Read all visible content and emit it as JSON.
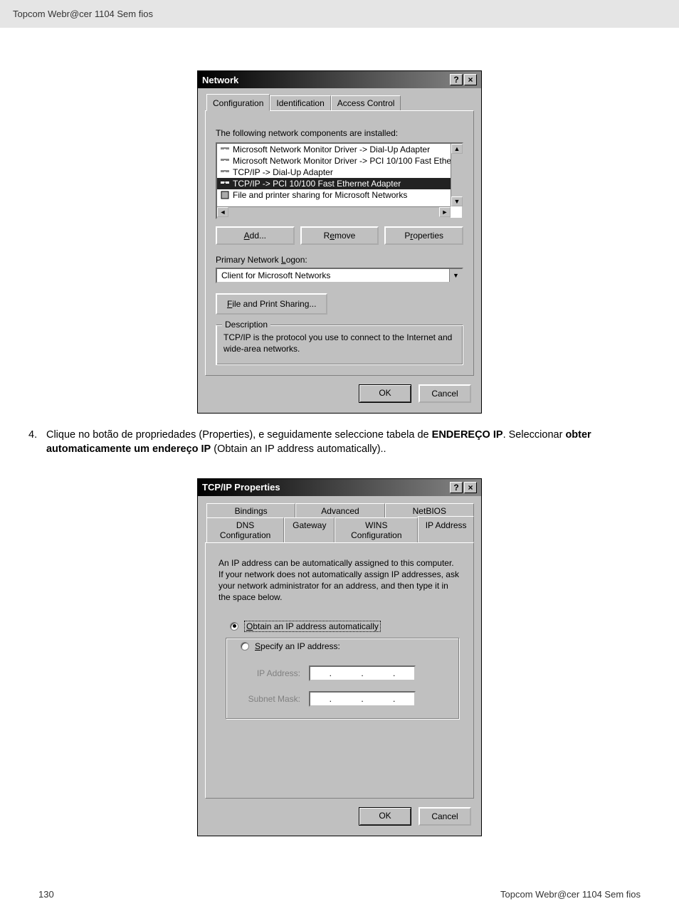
{
  "header": {
    "text": "Topcom  Webr@cer 1104 Sem fios"
  },
  "dialog1": {
    "title": "Network",
    "help_btn": "?",
    "close_btn": "×",
    "tabs": [
      "Configuration",
      "Identification",
      "Access Control"
    ],
    "components_label": "The following network components are installed:",
    "list": [
      "Microsoft Network Monitor Driver -> Dial-Up Adapter",
      "Microsoft Network Monitor Driver -> PCI 10/100 Fast Ethe",
      "TCP/IP -> Dial-Up Adapter",
      "TCP/IP -> PCI 10/100 Fast Ethernet Adapter",
      "File and printer sharing for Microsoft Networks"
    ],
    "add_btn": "Add...",
    "remove_btn": "Remove",
    "properties_btn": "Properties",
    "logon_label": "Primary Network Logon:",
    "logon_value": "Client for Microsoft Networks",
    "fps_btn": "File and Print Sharing...",
    "desc_legend": "Description",
    "desc_text": "TCP/IP is the protocol you use to connect to the Internet and wide-area networks.",
    "ok": "OK",
    "cancel": "Cancel"
  },
  "instruction": {
    "num": "4.",
    "text_pre": "Clique no botão de propriedades (Properties), e seguidamente seleccione tabela de ",
    "bold1": "ENDEREÇO IP",
    "text_mid": ". Seleccionar ",
    "bold2": "obter automaticamente um endereço IP",
    "text_post": " (Obtain an IP address automatically).."
  },
  "dialog2": {
    "title": "TCP/IP Properties",
    "help_btn": "?",
    "close_btn": "×",
    "tabs_row1": [
      "Bindings",
      "Advanced",
      "NetBIOS"
    ],
    "tabs_row2": [
      "DNS Configuration",
      "Gateway",
      "WINS Configuration",
      "IP Address"
    ],
    "info": "An IP address can be automatically assigned to this computer. If your network does not automatically assign IP addresses, ask your network administrator for an address, and then type it in the space below.",
    "radio1": "Obtain an IP address automatically",
    "radio2": "Specify an IP address:",
    "ip_label": "IP Address:",
    "mask_label": "Subnet Mask:",
    "ok": "OK",
    "cancel": "Cancel"
  },
  "footer": {
    "page": "130",
    "text": "Topcom  Webr@cer 1104 Sem fios"
  }
}
